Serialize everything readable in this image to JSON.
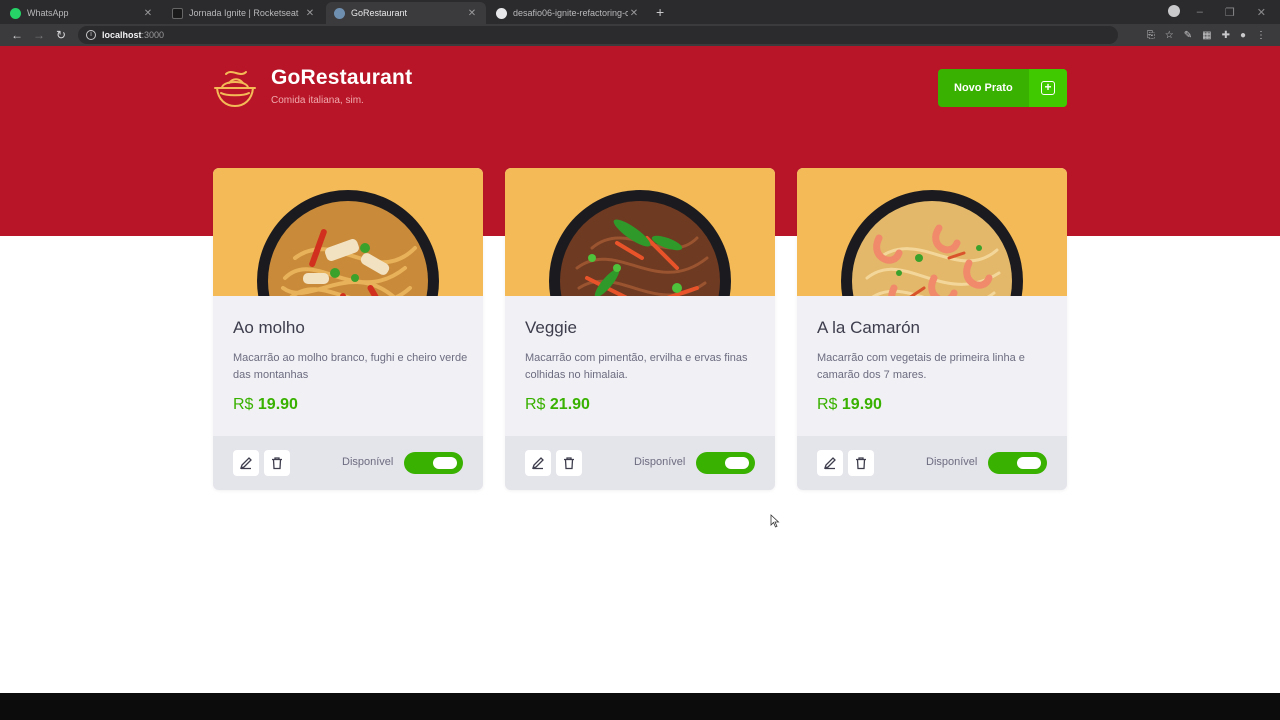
{
  "browser": {
    "tabs": [
      {
        "label": "WhatsApp",
        "active": false,
        "favicon_color": "#25d366"
      },
      {
        "label": "Jornada Ignite | Rocketseat",
        "active": false,
        "favicon_color": "#1a1a1a"
      },
      {
        "label": "GoRestaurant",
        "active": true,
        "favicon_color": "#6f8fb0"
      },
      {
        "label": "desafio06-ignite-refactoring-cla",
        "active": false,
        "favicon_color": "#e8e8ea"
      }
    ],
    "url_host": "localhost",
    "url_port": ":3000"
  },
  "header": {
    "title": "GoRestaurant",
    "subtitle": "Comida italiana, sim.",
    "new_button_label": "Novo Prato"
  },
  "colors": {
    "hero": "#b81628",
    "accent_green": "#39b100",
    "card_image_bg": "#f4ba57",
    "logo": "#f4ba57"
  },
  "foods": [
    {
      "name": "Ao molho",
      "description": "Macarrão ao molho branco, fughi e cheiro verde das montanhas",
      "currency": "R$",
      "price": "19.90",
      "available_label": "Disponível",
      "available": true
    },
    {
      "name": "Veggie",
      "description": "Macarrão com pimentão, ervilha e ervas finas colhidas no himalaia.",
      "currency": "R$",
      "price": "21.90",
      "available_label": "Disponível",
      "available": true
    },
    {
      "name": "A la Camarón",
      "description": "Macarrão com vegetais de primeira linha e camarão dos 7 mares.",
      "currency": "R$",
      "price": "19.90",
      "available_label": "Disponível",
      "available": true
    }
  ]
}
